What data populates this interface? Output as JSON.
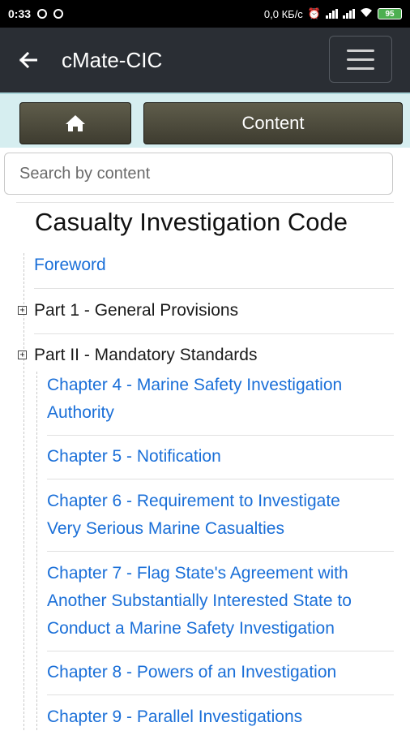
{
  "status_bar": {
    "time": "0:33",
    "network_speed": "0,0 КБ/с",
    "battery": "95",
    "icons": [
      "ring-icon",
      "ring-icon",
      "alarm-off-icon",
      "signal-icon",
      "signal-icon",
      "wifi-icon",
      "battery-icon"
    ]
  },
  "app_bar": {
    "title": "cMate-CIC",
    "back_icon": "arrow-left-icon",
    "menu_icon": "hamburger-menu-icon"
  },
  "tabs": {
    "home_icon": "home-icon",
    "content_label": "Content"
  },
  "search": {
    "placeholder": "Search by content",
    "value": ""
  },
  "content": {
    "title": "Casualty Investigation Code",
    "items": [
      {
        "label": "Foreword",
        "type": "link"
      },
      {
        "label": "Part 1 - General Provisions",
        "type": "collapsed"
      },
      {
        "label": "Part II - Mandatory Standards",
        "type": "expanded"
      }
    ],
    "chapters": [
      {
        "line1": "Chapter 4 - Marine Safety Investigation",
        "line2": "Authority",
        "line3": ""
      },
      {
        "line1": "Chapter 5 - Notification",
        "line2": "",
        "line3": ""
      },
      {
        "line1": "Chapter 6 - Requirement to Investigate",
        "line2": "Very Serious Marine Casualties",
        "line3": ""
      },
      {
        "line1": "Chapter 7 - Flag State's Agreement with",
        "line2": "Another Substantially Interested State to",
        "line3": "Conduct a Marine Safety Investigation"
      },
      {
        "line1": "Chapter 8 - Powers of an Investigation",
        "line2": "",
        "line3": ""
      },
      {
        "line1": "Chapter 9 - Parallel Investigations",
        "line2": "",
        "line3": ""
      }
    ]
  },
  "colors": {
    "link": "#1a6fd8",
    "app_bar": "#2a2e34",
    "tab_strip": "#d6eef0",
    "button": "#4e4c3e"
  }
}
